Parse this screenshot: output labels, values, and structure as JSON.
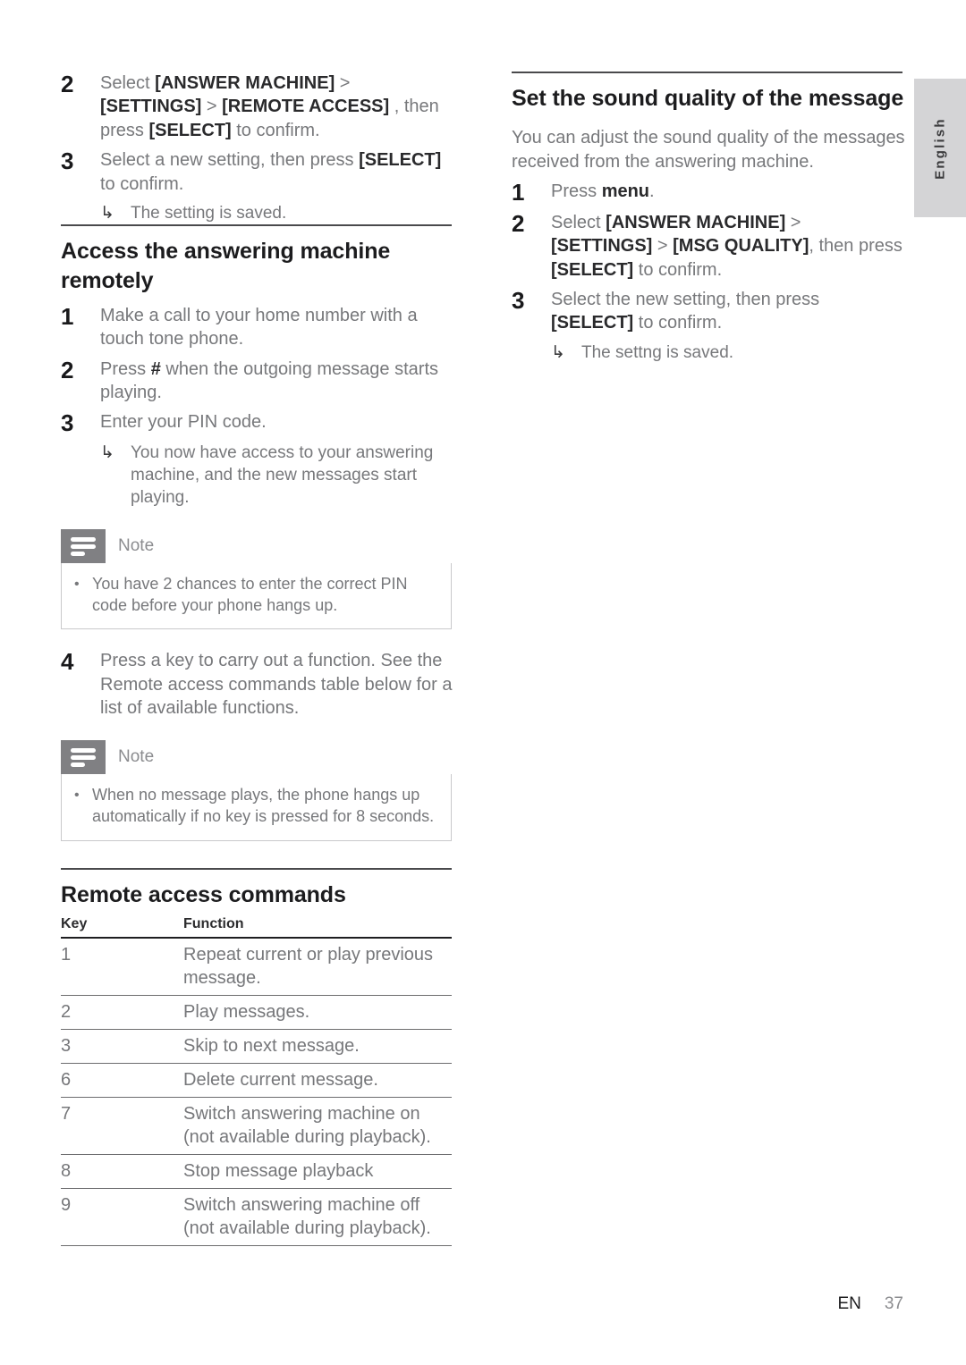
{
  "language_tab": {
    "label": "English"
  },
  "left_column": {
    "continued_steps": [
      {
        "number": "2",
        "segments": [
          {
            "text": "Select ",
            "bold": false
          },
          {
            "text": "[ANSWER MACHINE]",
            "bold": true
          },
          {
            "text": " > ",
            "bold": false
          },
          {
            "text": "[SETTINGS]",
            "bold": true
          },
          {
            "text": " > ",
            "bold": false
          },
          {
            "text": "[REMOTE ACCESS]",
            "bold": true
          },
          {
            "text": " , then press ",
            "bold": false
          },
          {
            "text": "[SELECT]",
            "bold": true
          },
          {
            "text": " to confirm.",
            "bold": false
          }
        ]
      },
      {
        "number": "3",
        "segments": [
          {
            "text": "Select a new setting, then press ",
            "bold": false
          },
          {
            "text": "[SELECT]",
            "bold": true
          },
          {
            "text": " to confirm.",
            "bold": false
          }
        ],
        "result": {
          "arrow": "↳",
          "text": "The setting is saved."
        }
      }
    ],
    "section": {
      "heading": "Access the answering machine remotely",
      "steps": [
        {
          "number": "1",
          "segments": [
            {
              "text": "Make a call to your home number with a touch tone phone.",
              "bold": false
            }
          ]
        },
        {
          "number": "2",
          "segments": [
            {
              "text": "Press ",
              "bold": false
            },
            {
              "text": "#",
              "bold": true
            },
            {
              "text": " when the outgoing message starts playing.",
              "bold": false
            }
          ]
        },
        {
          "number": "3",
          "segments": [
            {
              "text": "Enter your PIN code.",
              "bold": false
            }
          ],
          "result": {
            "arrow": "↳",
            "text": "You now have access to your answering machine, and the new messages start playing."
          }
        }
      ],
      "note_1": {
        "title": "Note",
        "bullet": "•",
        "items": [
          "You have 2 chances to enter the correct PIN code before your phone hangs up."
        ]
      },
      "step_4": {
        "number": "4",
        "segments": [
          {
            "text": "Press a key to carry out a function. See the Remote access commands table below for a list of available functions.",
            "bold": false
          }
        ]
      },
      "note_2": {
        "title": "Note",
        "bullet": "•",
        "items": [
          "When no message plays, the phone hangs up automatically if no key is pressed for 8 seconds."
        ]
      }
    },
    "table_section": {
      "heading": "Remote access commands",
      "columns": [
        "Key",
        "Function"
      ],
      "rows": [
        {
          "key": "1",
          "function": "Repeat current or play previous message."
        },
        {
          "key": "2",
          "function": "Play messages."
        },
        {
          "key": "3",
          "function": "Skip to next message."
        },
        {
          "key": "6",
          "function": "Delete current message."
        },
        {
          "key": "7",
          "function": "Switch answering machine on (not available during playback)."
        },
        {
          "key": "8",
          "function": "Stop message playback"
        },
        {
          "key": "9",
          "function": "Switch answering machine off (not available during playback)."
        }
      ]
    }
  },
  "right_column": {
    "heading": "Set the sound quality of the message",
    "intro": "You can adjust the sound quality of the messages received from the answering machine.",
    "steps": [
      {
        "number": "1",
        "segments": [
          {
            "text": "Press ",
            "bold": false
          },
          {
            "text": "menu",
            "bold": true
          },
          {
            "text": ".",
            "bold": false
          }
        ]
      },
      {
        "number": "2",
        "segments": [
          {
            "text": "Select ",
            "bold": false
          },
          {
            "text": "[ANSWER MACHINE]",
            "bold": true
          },
          {
            "text": " > ",
            "bold": false
          },
          {
            "text": "[SETTINGS]",
            "bold": true
          },
          {
            "text": " > ",
            "bold": false
          },
          {
            "text": "[MSG QUALITY]",
            "bold": true
          },
          {
            "text": ", then press ",
            "bold": false
          },
          {
            "text": "[SELECT]",
            "bold": true
          },
          {
            "text": " to confirm.",
            "bold": false
          }
        ]
      },
      {
        "number": "3",
        "segments": [
          {
            "text": "Select the new setting, then press ",
            "bold": false
          },
          {
            "text": "[SELECT]",
            "bold": true
          },
          {
            "text": " to confirm.",
            "bold": false
          }
        ],
        "result": {
          "arrow": "↳",
          "text": "The settng is saved."
        }
      }
    ]
  },
  "footer": {
    "language_code": "EN",
    "page_number": "37"
  }
}
